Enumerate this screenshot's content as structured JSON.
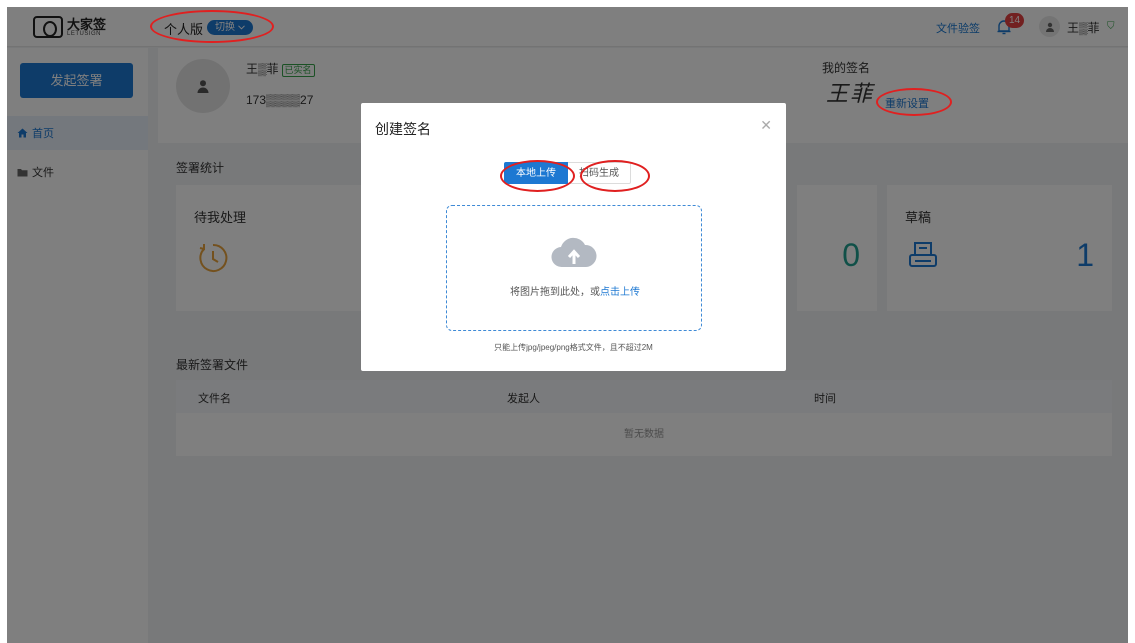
{
  "header": {
    "logo_cn": "大家签",
    "logo_en": "LETUSIGN",
    "edition": "个人版",
    "switch_label": "切换",
    "verify_link": "文件验签",
    "notification_count": "14",
    "user_name": "王▒菲"
  },
  "sidebar": {
    "start_button": "发起签署",
    "items": [
      {
        "label": "首页",
        "icon": "home-icon",
        "active": true
      },
      {
        "label": "文件",
        "icon": "folder-icon",
        "active": false
      }
    ]
  },
  "profile": {
    "name": "王▒菲",
    "verified_tag": "已实名",
    "phone": "173▒▒▒▒27",
    "signature_title": "我的签名",
    "signature_text": "王菲",
    "reset_link": "重新设置"
  },
  "stats": {
    "title": "签署统计",
    "pending_label": "待我处理",
    "mid_value": "0",
    "draft_label": "草稿",
    "draft_value": "1"
  },
  "latest": {
    "title": "最新签署文件",
    "columns": [
      "文件名",
      "发起人",
      "时间"
    ],
    "empty_text": "暂无数据"
  },
  "modal": {
    "title": "创建签名",
    "tabs": [
      "本地上传",
      "扫码生成"
    ],
    "drop_text": "将图片拖到此处，或",
    "drop_link": "点击上传",
    "hint": "只能上传jpg/jpeg/png格式文件，且不超过2M"
  },
  "colors": {
    "primary": "#1d78d2",
    "annotation_red": "#e02020",
    "badge_red": "#e54040",
    "teal": "#20a090"
  }
}
